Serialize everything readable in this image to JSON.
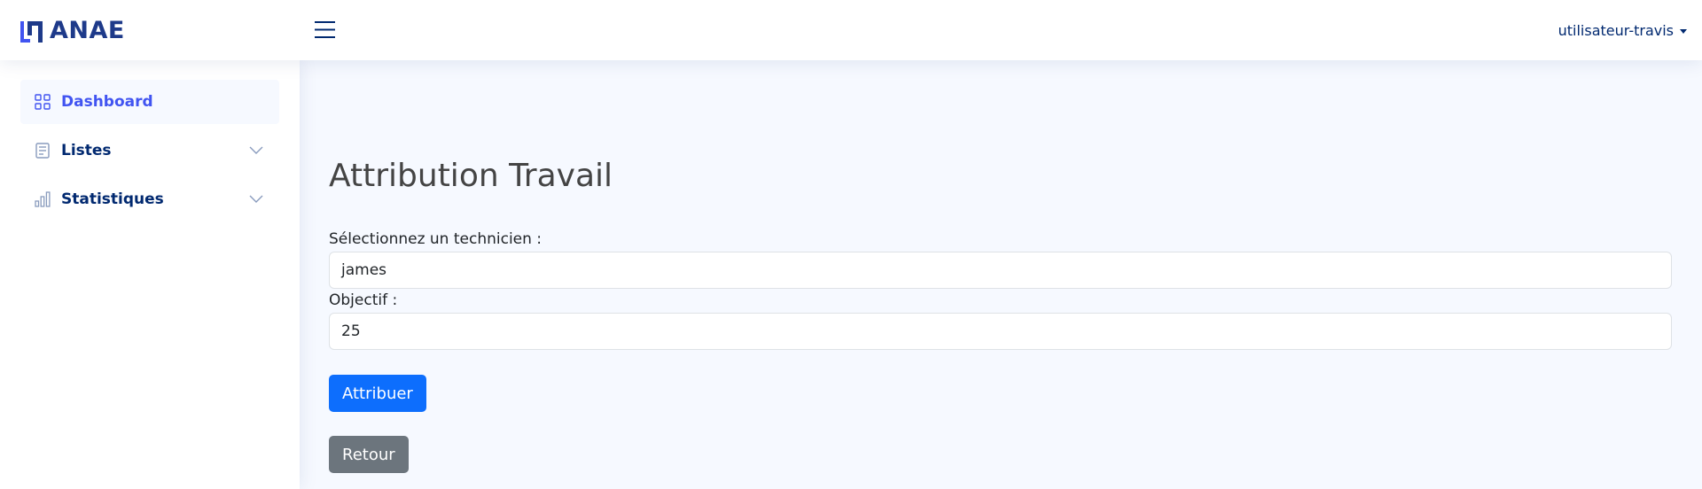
{
  "brand": {
    "name": "ANAE",
    "color": "#1e3a8a",
    "accent": "#4154f1"
  },
  "header": {
    "menu_icon": "hamburger-icon",
    "user": "utilisateur-travis"
  },
  "sidebar": {
    "items": [
      {
        "label": "Dashboard",
        "icon": "grid-icon",
        "active": true
      },
      {
        "label": "Listes",
        "icon": "list-icon",
        "expandable": true
      },
      {
        "label": "Statistiques",
        "icon": "bar-chart-icon",
        "expandable": true
      }
    ]
  },
  "main": {
    "title": "Attribution Travail",
    "technician_label": "Sélectionnez un technicien :",
    "technician_value": "james",
    "objective_label": "Objectif :",
    "objective_value": "25",
    "submit_label": "Attribuer",
    "back_label": "Retour"
  },
  "colors": {
    "primary": "#0d6efd",
    "secondary": "#6c757d",
    "background": "#f6f9ff"
  }
}
